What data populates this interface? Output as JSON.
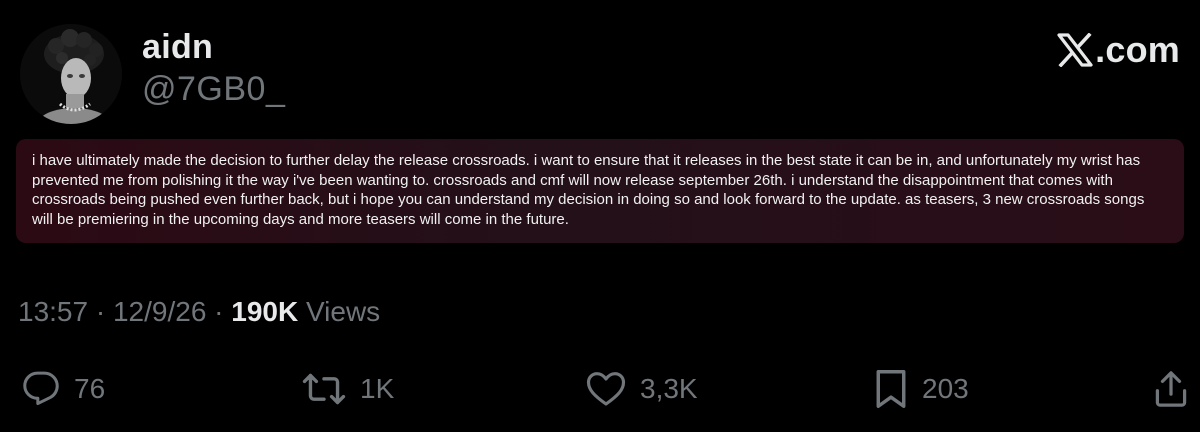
{
  "author": {
    "display_name": "aidn",
    "handle": "@7GB0_"
  },
  "brand": {
    "logo_text": ".com",
    "logo_icon": "x-logo-icon"
  },
  "post": {
    "text": "i have ultimately made the decision to further delay the release crossroads. i want to ensure that it releases in the best state it can be in, and unfortunately my wrist has prevented me from polishing it the way i've been wanting to. crossroads and cmf will now release september 26th. i understand the disappointment that comes with crossroads being pushed even further back, but i hope you can understand my decision in doing so and look forward to the update. as teasers, 3 new crossroads songs will be premiering in the upcoming days and more teasers will come in the future."
  },
  "meta": {
    "time": "13:57",
    "separator": " · ",
    "date": "12/9/26",
    "views_count": "190K",
    "views_label": " Views"
  },
  "actions": {
    "replies": "76",
    "reposts": "1K",
    "likes": "3,3K",
    "bookmarks": "203"
  },
  "colors": {
    "background": "#000000",
    "text_primary": "#e7e9ea",
    "text_secondary": "#71767b",
    "post_highlight": "#2a0d17"
  }
}
